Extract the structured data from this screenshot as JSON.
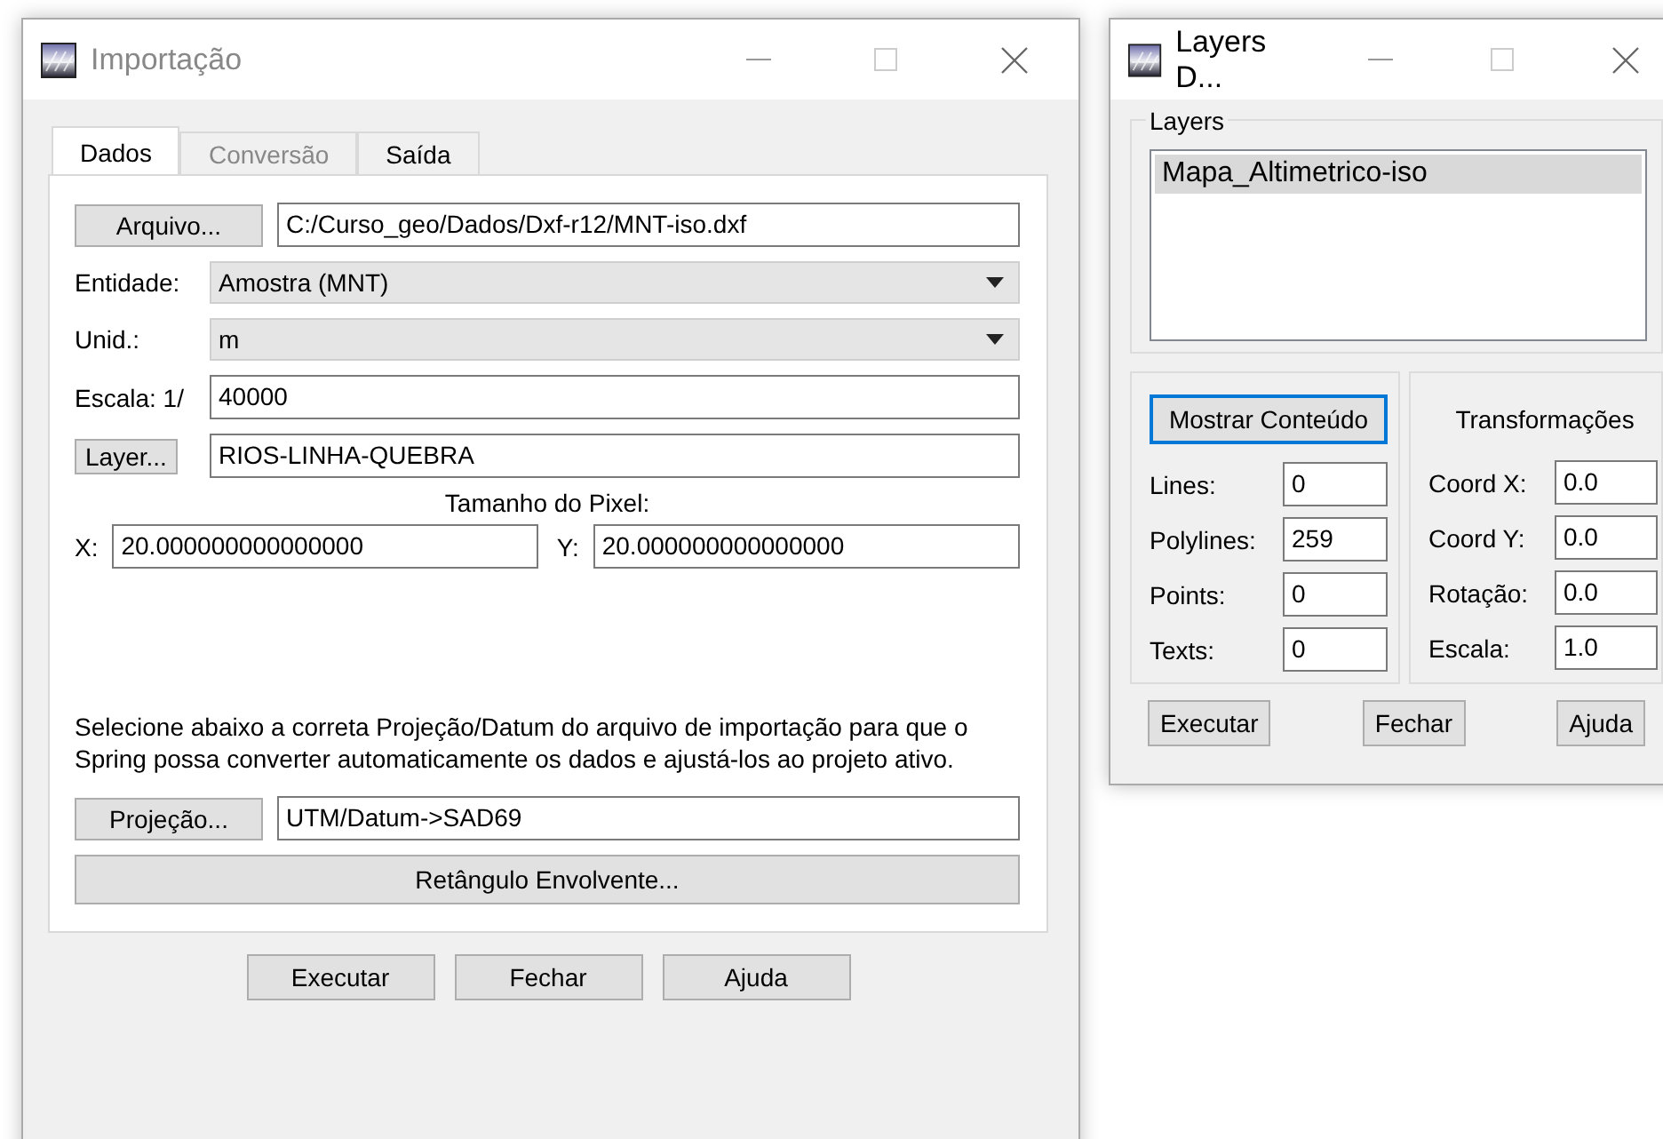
{
  "import_window": {
    "title": "Importação",
    "tabs": [
      {
        "label": "Dados",
        "selected": true,
        "disabled": false
      },
      {
        "label": "Conversão",
        "selected": false,
        "disabled": true
      },
      {
        "label": "Saída",
        "selected": false,
        "disabled": false
      }
    ],
    "file": {
      "button": "Arquivo...",
      "value": "C:/Curso_geo/Dados/Dxf-r12/MNT-iso.dxf"
    },
    "entity": {
      "label": "Entidade:",
      "value": "Amostra (MNT)"
    },
    "unit": {
      "label": "Unid.:",
      "value": "m"
    },
    "scale": {
      "label": "Escala: 1/",
      "value": "40000"
    },
    "layer": {
      "button": "Layer...",
      "value": "RIOS-LINHA-QUEBRA"
    },
    "pixel_size": {
      "title": "Tamanho do Pixel:",
      "x_label": "X:",
      "x_value": "20.000000000000000",
      "y_label": "Y:",
      "y_value": "20.000000000000000"
    },
    "note": "Selecione abaixo a correta Projeção/Datum do arquivo de importação para que o Spring possa converter automaticamente os dados e ajustá-los ao projeto ativo.",
    "projection": {
      "button": "Projeção...",
      "value": "UTM/Datum->SAD69"
    },
    "bounding_button": "Retângulo Envolvente...",
    "buttons": [
      "Executar",
      "Fechar",
      "Ajuda"
    ]
  },
  "layers_window": {
    "title": "Layers D...",
    "group_title": "Layers",
    "layers": [
      {
        "name": "Mapa_Altimetrico-iso",
        "selected": true
      }
    ],
    "show_button": {
      "label": "Mostrar Conteúdo",
      "focused": true
    },
    "counts": [
      {
        "label": "Lines:",
        "value": "0"
      },
      {
        "label": "Polylines:",
        "value": "259"
      },
      {
        "label": "Points:",
        "value": "0"
      },
      {
        "label": "Texts:",
        "value": "0"
      }
    ],
    "transform_title": "Transformações",
    "transforms": [
      {
        "label": "Coord X:",
        "value": "0.0"
      },
      {
        "label": "Coord Y:",
        "value": "0.0"
      },
      {
        "label": "Rotação:",
        "value": "0.0"
      },
      {
        "label": "Escala:",
        "value": "1.0"
      }
    ],
    "buttons": [
      "Executar",
      "Fechar",
      "Ajuda"
    ]
  }
}
